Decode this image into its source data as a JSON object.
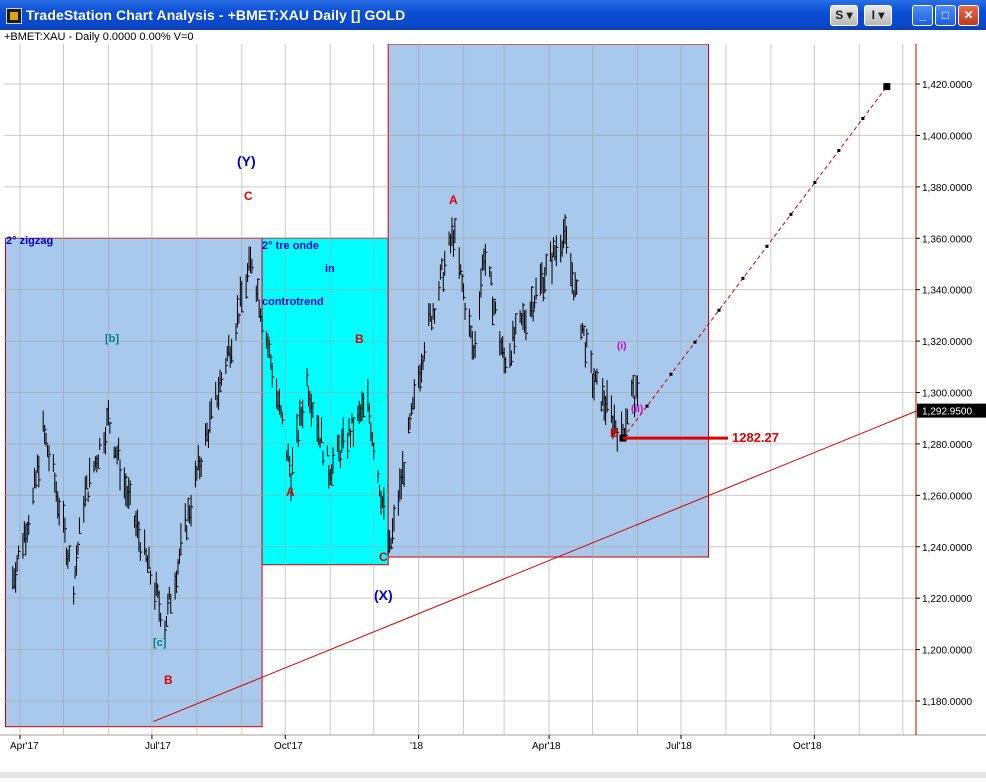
{
  "window": {
    "title": "TradeStation Chart Analysis - +BMET:XAU Daily [] GOLD",
    "buttons": {
      "s_menu": "S",
      "i_menu": "I",
      "minimize": "_",
      "maximize": "□",
      "close": "✕"
    }
  },
  "infobar": {
    "text": "+BMET:XAU - Daily  0.0000  0.00%  V=0"
  },
  "chart_data": {
    "type": "line",
    "symbol": "+BMET:XAU",
    "interval": "Daily",
    "y_axis": {
      "ticks": [
        "1,180.0000",
        "1,200.0000",
        "1,220.0000",
        "1,240.0000",
        "1,260.0000",
        "1,280.0000",
        "1,300.0000",
        "1,320.0000",
        "1,340.0000",
        "1,360.0000",
        "1,380.0000",
        "1,400.0000",
        "1,420.0000"
      ],
      "ylim": [
        1170,
        1440
      ],
      "last_price_label": "1,292.9500",
      "last_price": 1292.95
    },
    "x_axis": {
      "ticks": [
        "Apr'17",
        "Jul'17",
        "Oct'17",
        "'18",
        "Apr'18",
        "Jul'18",
        "Oct'18"
      ]
    },
    "price_path": [
      {
        "x": "2017-03-27",
        "y": 1228
      },
      {
        "x": "2017-04-10",
        "y": 1258
      },
      {
        "x": "2017-04-17",
        "y": 1285
      },
      {
        "x": "2017-04-24",
        "y": 1268
      },
      {
        "x": "2017-05-08",
        "y": 1226
      },
      {
        "x": "2017-05-15",
        "y": 1258
      },
      {
        "x": "2017-06-01",
        "y": 1290
      },
      {
        "x": "2017-06-15",
        "y": 1258
      },
      {
        "x": "2017-07-10",
        "y": 1210
      },
      {
        "x": "2017-08-01",
        "y": 1268
      },
      {
        "x": "2017-09-08",
        "y": 1352
      },
      {
        "x": "2017-09-25",
        "y": 1300
      },
      {
        "x": "2017-10-05",
        "y": 1268
      },
      {
        "x": "2017-10-16",
        "y": 1305
      },
      {
        "x": "2017-10-31",
        "y": 1270
      },
      {
        "x": "2017-11-27",
        "y": 1296
      },
      {
        "x": "2017-12-12",
        "y": 1238
      },
      {
        "x": "2018-01-05",
        "y": 1320
      },
      {
        "x": "2018-01-25",
        "y": 1362
      },
      {
        "x": "2018-02-08",
        "y": 1315
      },
      {
        "x": "2018-02-15",
        "y": 1355
      },
      {
        "x": "2018-03-01",
        "y": 1312
      },
      {
        "x": "2018-04-11",
        "y": 1362
      },
      {
        "x": "2018-05-01",
        "y": 1305
      },
      {
        "x": "2018-05-15",
        "y": 1290
      },
      {
        "x": "2018-05-21",
        "y": 1283
      },
      {
        "x": "2018-05-28",
        "y": 1300
      },
      {
        "x": "2018-06-01",
        "y": 1297
      }
    ],
    "projection": {
      "from": {
        "x": "2018-05-22",
        "y": 1282.27
      },
      "to": {
        "x": "2018-11-20",
        "y": 1419
      }
    },
    "support_level": {
      "value": 1282.27,
      "label": "1282.27"
    },
    "trendline": {
      "from": {
        "x": "2017-07-02",
        "y": 1172
      },
      "to": {
        "x": "2018-12-20",
        "y": 1295
      }
    },
    "zones": [
      {
        "label": "2° zigzag",
        "color": "#a8c8ec",
        "from": "2017-03-22",
        "to": "2017-09-15",
        "y_from": 1170,
        "y_to": 1360
      },
      {
        "label": "2° tre onde",
        "color": "#00ffff",
        "from": "2017-09-15",
        "to": "2017-12-11",
        "y_from": 1233,
        "y_to": 1360
      },
      {
        "label": "",
        "color": "#a8c8ec",
        "from": "2017-12-11",
        "to": "2018-07-20",
        "y_from": 1236,
        "y_to": 1440
      }
    ],
    "zone_text": {
      "in": "in",
      "controtrend": "controtrend"
    },
    "wave_labels": [
      {
        "text": "(Y)",
        "color": "#0000cc"
      },
      {
        "text": "C",
        "color": "#e00000"
      },
      {
        "text": "[b]",
        "color": "#008080"
      },
      {
        "text": "[c]",
        "color": "#008080"
      },
      {
        "text": "B",
        "color": "#e00000"
      },
      {
        "text": "B",
        "color": "#e00000"
      },
      {
        "text": "A",
        "color": "#e00000"
      },
      {
        "text": "C",
        "color": "#e00000"
      },
      {
        "text": "(X)",
        "color": "#0000cc"
      },
      {
        "text": "A",
        "color": "#e00000"
      },
      {
        "text": "B",
        "color": "#e00000"
      },
      {
        "text": "(i)",
        "color": "#cc00cc"
      },
      {
        "text": "(ii)",
        "color": "#cc00cc"
      }
    ],
    "colors": {
      "grid": "#a0a0a0",
      "bars": "#000000",
      "trend": "#d00000",
      "axis_border": "#d00000",
      "level": "#e00000"
    },
    "grid": true
  }
}
